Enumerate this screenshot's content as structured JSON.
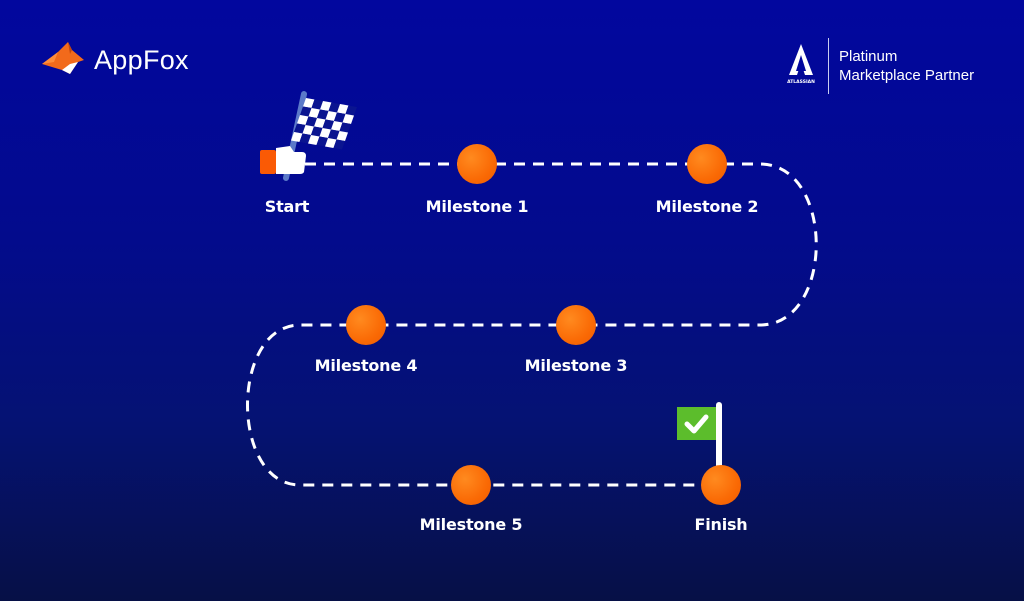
{
  "brand": {
    "name": "AppFox",
    "logo_icon": "fox-icon"
  },
  "partner": {
    "logo_icon": "atlassian-icon",
    "logo_caption": "ATLASSIAN",
    "line1": "Platinum",
    "line2": "Marketplace Partner"
  },
  "colors": {
    "background_top": "#02079e",
    "background_bottom": "#061046",
    "milestone": "#fa6a05",
    "path": "#ffffff",
    "finish_flag": "#5cbd2c",
    "start_cuff": "#fa5a05"
  },
  "roadmap": {
    "start": {
      "label": "Start",
      "icon": "checkered-flag-icon"
    },
    "milestones": [
      {
        "label": "Milestone 1"
      },
      {
        "label": "Milestone 2"
      },
      {
        "label": "Milestone 3"
      },
      {
        "label": "Milestone 4"
      },
      {
        "label": "Milestone 5"
      }
    ],
    "finish": {
      "label": "Finish",
      "icon": "check-flag-icon"
    }
  }
}
